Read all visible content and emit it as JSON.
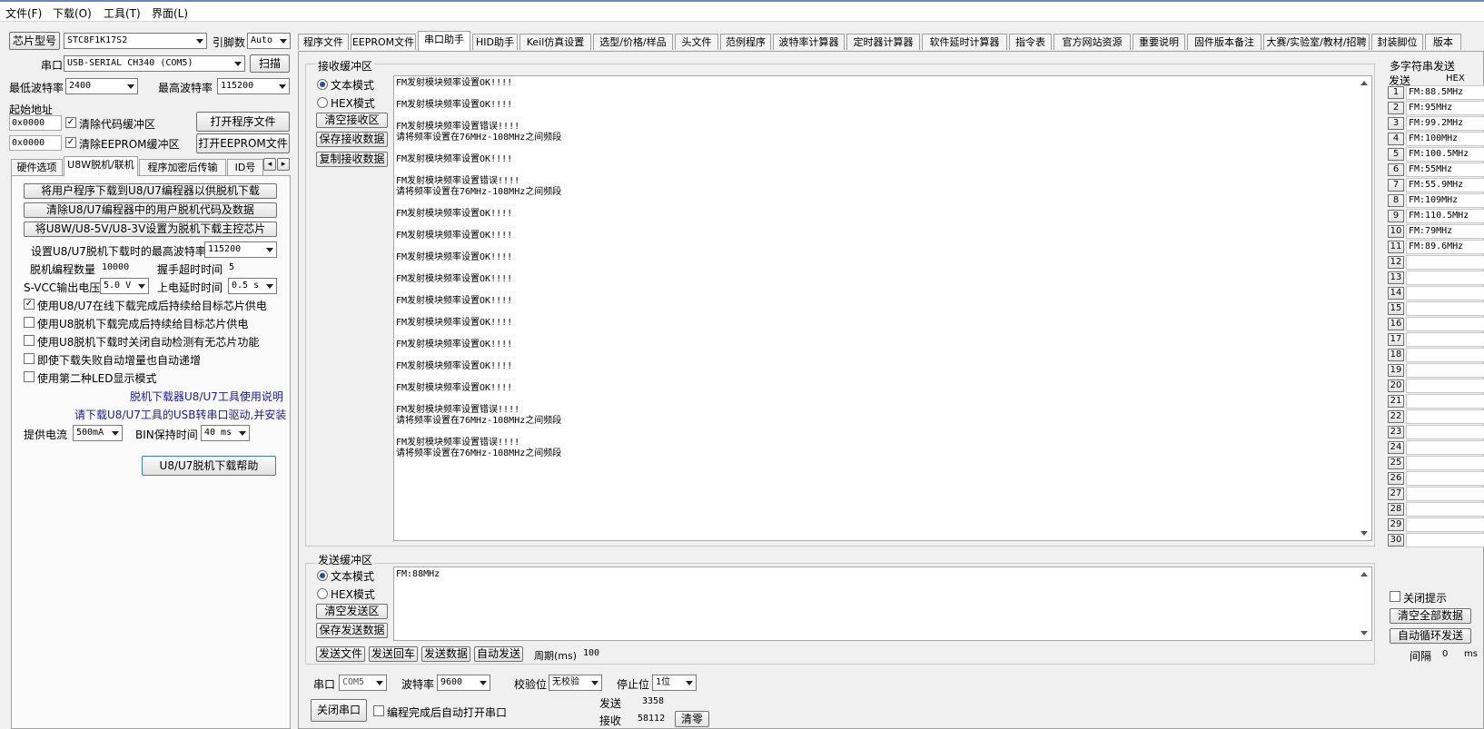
{
  "menu": {
    "file": "文件(F)",
    "download": "下载(O)",
    "tools": "工具(T)",
    "ui": "界面(L)"
  },
  "left": {
    "chip_btn": "芯片型号",
    "chip_value": "STC8F1K17S2",
    "pin_label": "引脚数",
    "pin_value": "Auto",
    "port_label": "串口",
    "port_value": "USB-SERIAL CH340 (COM5)",
    "scan_btn": "扫描",
    "min_baud_label": "最低波特率",
    "min_baud_value": "2400",
    "max_baud_label": "最高波特率",
    "max_baud_value": "115200",
    "start_addr_label": "起始地址",
    "addr1": "0x0000",
    "clear_code_cb": "清除代码缓冲区",
    "open_prog_btn": "打开程序文件",
    "addr2": "0x0000",
    "clear_eeprom_cb": "清除EEPROM缓冲区",
    "open_eeprom_btn": "打开EEPROM文件",
    "tabs": [
      "硬件选项",
      "U8W脱机/联机",
      "程序加密后传输",
      "ID号"
    ],
    "btn1": "将用户程序下载到U8/U7编程器以供脱机下载",
    "btn2": "清除U8/U7编程器中的用户脱机代码及数据",
    "btn3": "将U8W/U8-5V/U8-3V设置为脱机下载主控芯片",
    "max_baud_set_label": "设置U8/U7脱机下载时的最高波特率",
    "max_baud_set_value": "115200",
    "offline_count_label": "脱机编程数量",
    "offline_count_value": "10000",
    "handshake_label": "握手超时时间",
    "handshake_value": "5",
    "svcc_label": "S-VCC输出电压",
    "svcc_value": "5.0 V",
    "delay_label": "上电延时时间",
    "delay_value": "0.5 s",
    "cb1": "使用U8/U7在线下载完成后持续给目标芯片供电",
    "cb2": "使用U8脱机下载完成后持续给目标芯片供电",
    "cb3": "使用U8脱机下载时关闭自动检测有无芯片功能",
    "cb4": "即使下载失败自动增量也自动递增",
    "cb5": "使用第二种LED显示模式",
    "link1": "脱机下载器U8/U7工具使用说明",
    "link2": "请下载U8/U7工具的USB转串口驱动,并安装",
    "current_label": "提供电流",
    "current_value": "500mA",
    "bin_label": "BIN保持时间",
    "bin_value": "40 ms",
    "help_btn": "U8/U7脱机下载帮助"
  },
  "tabs": [
    "程序文件",
    "EEPROM文件",
    "串口助手",
    "HID助手",
    "Keil仿真设置",
    "选型/价格/样品",
    "头文件",
    "范例程序",
    "波特率计算器",
    "定时器计算器",
    "软件延时计算器",
    "指令表",
    "官方网站资源",
    "重要说明",
    "固件版本备注",
    "大赛/实验室/教材/招聘",
    "封装脚位",
    "版本"
  ],
  "recv": {
    "title": "接收缓冲区",
    "text_mode": "文本模式",
    "hex_mode": "HEX模式",
    "clear_btn": "清空接收区",
    "save_btn": "保存接收数据",
    "copy_btn": "复制接收数据",
    "lines": [
      "FM发射模块频率设置OK!!!!",
      "",
      "FM发射模块频率设置OK!!!!",
      "",
      "FM发射模块频率设置错误!!!!",
      "请将频率设置在76MHz-108MHz之间频段",
      "",
      "FM发射模块频率设置OK!!!!",
      "",
      "FM发射模块频率设置错误!!!!",
      "请将频率设置在76MHz-108MHz之间频段",
      "",
      "FM发射模块频率设置OK!!!!",
      "",
      "FM发射模块频率设置OK!!!!",
      "",
      "FM发射模块频率设置OK!!!!",
      "",
      "FM发射模块频率设置OK!!!!",
      "",
      "FM发射模块频率设置OK!!!!",
      "",
      "FM发射模块频率设置OK!!!!",
      "",
      "FM发射模块频率设置OK!!!!",
      "",
      "FM发射模块频率设置OK!!!!",
      "",
      "FM发射模块频率设置OK!!!!",
      "",
      "FM发射模块频率设置错误!!!!",
      "请将频率设置在76MHz-108MHz之间频段",
      "",
      "FM发射模块频率设置错误!!!!",
      "请将频率设置在76MHz-108MHz之间频段"
    ]
  },
  "send": {
    "title": "发送缓冲区",
    "text_mode": "文本模式",
    "hex_mode": "HEX模式",
    "clear_btn": "清空发送区",
    "save_btn": "保存发送数据",
    "content": "FM:88MHz",
    "send_file": "发送文件",
    "send_enter": "发送回车",
    "send_data": "发送数据",
    "auto_send": "自动发送",
    "period_label": "周期(ms)",
    "period_value": "100"
  },
  "serial": {
    "port_label": "串口",
    "port_value": "COM5",
    "baud_label": "波特率",
    "baud_value": "9600",
    "parity_label": "校验位",
    "parity_value": "无校验",
    "stop_label": "停止位",
    "stop_value": "1位",
    "close_btn": "关闭串口",
    "auto_open_cb": "编程完成后自动打开串口",
    "sent_label": "发送",
    "sent_value": "3358",
    "recv_label": "接收",
    "recv_value": "58112",
    "clear_btn": "清零"
  },
  "multi": {
    "title": "多字符串发送",
    "send_col": "发送",
    "hex_col": "HEX",
    "items": [
      {
        "n": "1",
        "v": "FM:88.5MHz"
      },
      {
        "n": "2",
        "v": "FM:95MHz"
      },
      {
        "n": "3",
        "v": "FM:99.2MHz"
      },
      {
        "n": "4",
        "v": "FM:100MHz"
      },
      {
        "n": "5",
        "v": "FM:100.5MHz"
      },
      {
        "n": "6",
        "v": "FM:55MHz"
      },
      {
        "n": "7",
        "v": "FM:55.9MHz"
      },
      {
        "n": "8",
        "v": "FM:109MHz"
      },
      {
        "n": "9",
        "v": "FM:110.5MHz"
      },
      {
        "n": "10",
        "v": "FM:79MHz"
      },
      {
        "n": "11",
        "v": "FM:89.6MHz"
      },
      {
        "n": "12",
        "v": ""
      },
      {
        "n": "13",
        "v": ""
      },
      {
        "n": "14",
        "v": ""
      },
      {
        "n": "15",
        "v": ""
      },
      {
        "n": "16",
        "v": ""
      },
      {
        "n": "17",
        "v": ""
      },
      {
        "n": "18",
        "v": ""
      },
      {
        "n": "19",
        "v": ""
      },
      {
        "n": "20",
        "v": ""
      },
      {
        "n": "21",
        "v": ""
      },
      {
        "n": "22",
        "v": ""
      },
      {
        "n": "23",
        "v": ""
      },
      {
        "n": "24",
        "v": ""
      },
      {
        "n": "25",
        "v": ""
      },
      {
        "n": "26",
        "v": ""
      },
      {
        "n": "27",
        "v": ""
      },
      {
        "n": "28",
        "v": ""
      },
      {
        "n": "29",
        "v": ""
      },
      {
        "n": "30",
        "v": ""
      }
    ],
    "close_tip_cb": "关闭提示",
    "clear_all_btn": "清空全部数据",
    "auto_loop_btn": "自动循环发送",
    "interval_label": "间隔",
    "interval_value": "0",
    "interval_unit": "ms"
  }
}
